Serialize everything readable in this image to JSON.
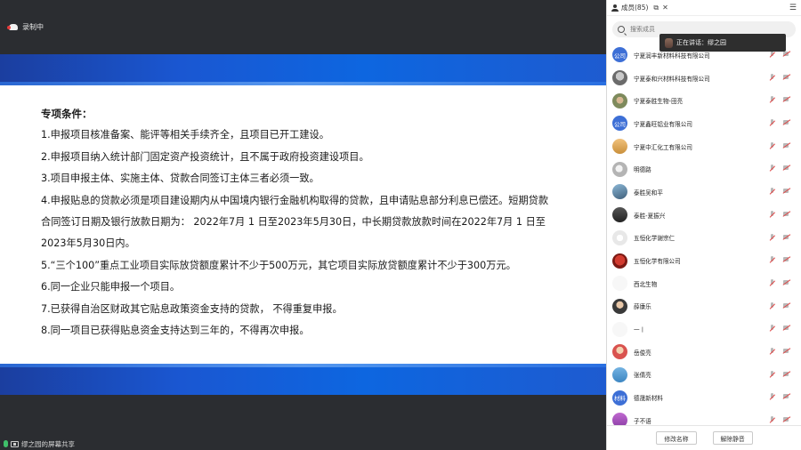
{
  "recording": {
    "label": "录制中"
  },
  "slide": {
    "heading": "专项条件：",
    "lines": [
      "1.申报项目核准备案、能评等相关手续齐全，且项目已开工建设。",
      "2.申报项目纳入统计部门固定资产投资统计，且不属于政府投资建设项目。",
      "3.项目申报主体、实施主体、贷款合同签订主体三者必须一致。",
      "4.申报贴息的贷款必须是项目建设期内从中国境内银行金融机构取得的贷款，且申请贴息部分利息已偿还。短期贷款",
      "合同签订日期及银行放款日期为： 2022年7月 1 日至2023年5月30日，中长期贷款放款时间在2022年7月 1 日至",
      "2023年5月30日内。",
      "5.“三个100”重点工业项目实际放贷额度累计不少于500万元，其它项目实际放贷额度累计不少于300万元。",
      "6.同一企业只能申报一个项目。",
      "7.已获得自治区财政其它贴息政策资金支持的贷款， 不得重复申报。",
      "8.同一项目已获得贴息资金支持达到三年的，不得再次申报。"
    ]
  },
  "share_status": {
    "label": "缪之园的屏幕共享"
  },
  "panel": {
    "title": "成员(85)",
    "search_placeholder": "搜索成员",
    "speaking_label": "正在讲话：缪之园",
    "members": [
      {
        "name": "宁夏润丰新材料科技有限公司",
        "avatar_text": "公司",
        "avatar_class": "av-blue"
      },
      {
        "name": "宁夏泰和兴材料科技有限公司",
        "avatar_text": "",
        "avatar_class": "av-photo1"
      },
      {
        "name": "宁夏泰胜生物-田亮",
        "avatar_text": "",
        "avatar_class": "av-photo2"
      },
      {
        "name": "宁夏鑫旺铝业有限公司",
        "avatar_text": "公司",
        "avatar_class": "av-blue"
      },
      {
        "name": "宁夏中汇化工有限公司",
        "avatar_text": "",
        "avatar_class": "av-photo3"
      },
      {
        "name": "明德路",
        "avatar_text": "",
        "avatar_class": "av-photo4"
      },
      {
        "name": "泰胜吴和平",
        "avatar_text": "",
        "avatar_class": "av-photo5"
      },
      {
        "name": "泰胜-夏振兴",
        "avatar_text": "",
        "avatar_class": "av-photo6"
      },
      {
        "name": "五恒化学谢宗仁",
        "avatar_text": "",
        "avatar_class": "av-photo7"
      },
      {
        "name": "五恒化学有限公司",
        "avatar_text": "",
        "avatar_class": "av-photo8"
      },
      {
        "name": "西北生物",
        "avatar_text": "",
        "avatar_class": "av-blank"
      },
      {
        "name": "薛康乐",
        "avatar_text": "",
        "avatar_class": "av-photo9"
      },
      {
        "name": "一丨",
        "avatar_text": "",
        "avatar_class": "av-blank"
      },
      {
        "name": "岳俊亮",
        "avatar_text": "",
        "avatar_class": "av-photo10"
      },
      {
        "name": "张倩亮",
        "avatar_text": "",
        "avatar_class": "av-photo11"
      },
      {
        "name": "德晟新材料",
        "avatar_text": "材料",
        "avatar_class": "av-blue"
      },
      {
        "name": "子不语",
        "avatar_text": "",
        "avatar_class": "av-photo12"
      }
    ],
    "footer": {
      "rename_label": "修改名称",
      "unmute_label": "解除静音"
    }
  }
}
